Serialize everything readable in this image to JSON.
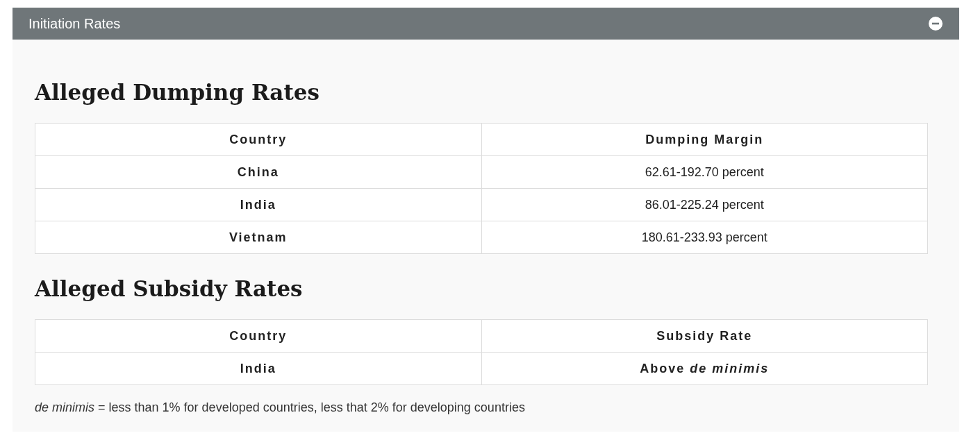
{
  "panel": {
    "title": "Initiation Rates",
    "expanded": true
  },
  "sections": [
    {
      "heading": "Alleged Dumping Rates",
      "columns": [
        "Country",
        "Dumping Margin"
      ],
      "rows": [
        {
          "country": "China",
          "value": "62.61-192.70 percent",
          "value_bold": false
        },
        {
          "country": "India",
          "value": "86.01-225.24 percent",
          "value_bold": false
        },
        {
          "country": "Vietnam",
          "value": "180.61-233.93 percent",
          "value_bold": false
        }
      ]
    },
    {
      "heading": "Alleged Subsidy Rates",
      "columns": [
        "Country",
        "Subsidy Rate"
      ],
      "rows": [
        {
          "country": "India",
          "value": "Above *de minimis*",
          "value_bold": true
        }
      ]
    }
  ],
  "footnote": "*de minimis* = less than 1% for developed countries, less that 2% for developing countries"
}
